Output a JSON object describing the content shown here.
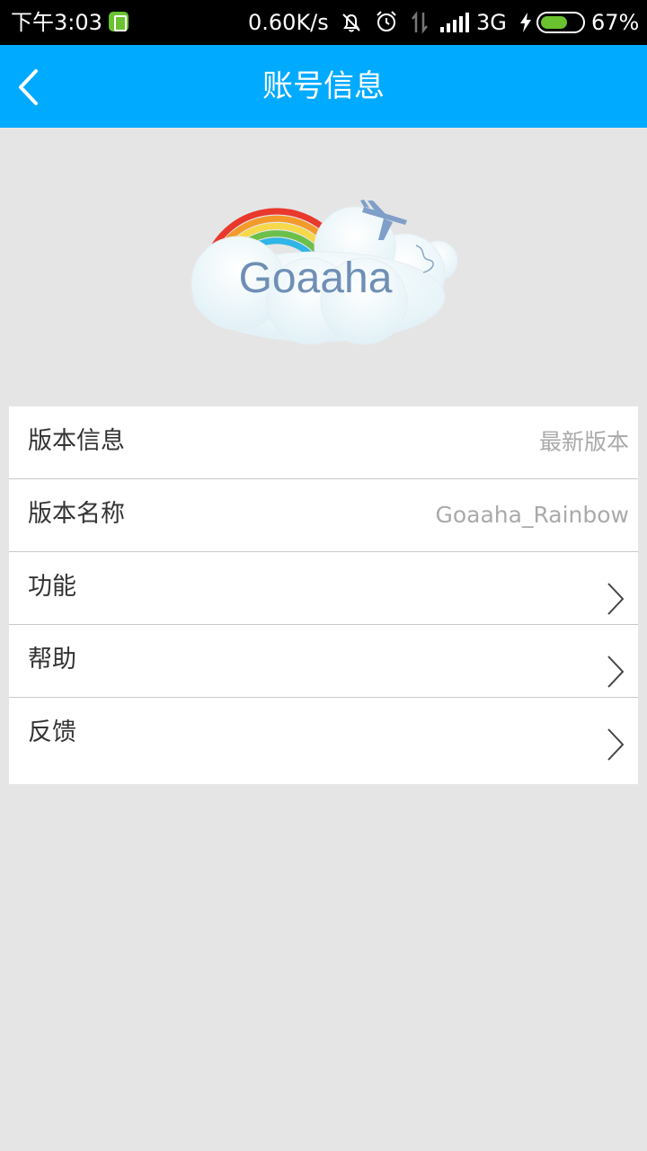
{
  "status_bar": {
    "time": "下午3:03",
    "net_speed": "0.60K/s",
    "network_type": "3G",
    "battery_percent": "67%",
    "battery_level": 0.67,
    "icons": [
      "app-notification-icon",
      "bell-off-icon",
      "alarm-icon",
      "data-arrows-icon",
      "signal-icon",
      "charging-icon",
      "battery-icon"
    ]
  },
  "header": {
    "title": "账号信息",
    "back_icon": "chevron-left-icon",
    "background": "#00aaff"
  },
  "logo": {
    "text": "Goaaha"
  },
  "list": {
    "rows": [
      {
        "label": "版本信息",
        "value": "最新版本"
      },
      {
        "label": "版本名称",
        "value": "Goaaha_Rainbow"
      },
      {
        "label": "功能",
        "icon": "chevron-right-icon"
      },
      {
        "label": "帮助",
        "icon": "chevron-right-icon"
      },
      {
        "label": "反馈",
        "icon": "chevron-right-icon"
      }
    ]
  }
}
